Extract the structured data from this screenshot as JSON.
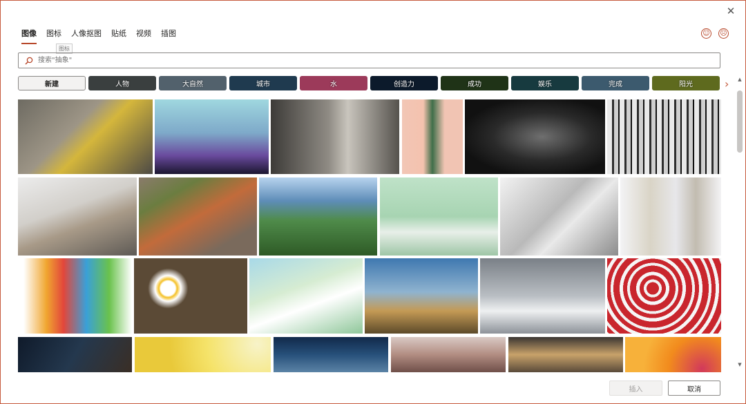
{
  "close_icon": "close-icon",
  "tabs": [
    {
      "label": "图像",
      "active": true
    },
    {
      "label": "图标"
    },
    {
      "label": "人像抠图"
    },
    {
      "label": "贴纸"
    },
    {
      "label": "视频"
    },
    {
      "label": "插图"
    }
  ],
  "tooltip": "图标",
  "feedback": {
    "happy_icon": "smile-icon",
    "sad_icon": "frown-icon"
  },
  "search": {
    "placeholder": "搜索\"抽象\"",
    "value": "",
    "icon": "search-icon"
  },
  "categories": [
    {
      "label": "新建",
      "color": "#f3f2f1"
    },
    {
      "label": "人物",
      "color": "#3a3f3f"
    },
    {
      "label": "大自然",
      "color": "#52616c"
    },
    {
      "label": "城市",
      "color": "#1f3a4f"
    },
    {
      "label": "水",
      "color": "#9c3a5a"
    },
    {
      "label": "创造力",
      "color": "#0c1a2b"
    },
    {
      "label": "成功",
      "color": "#1f3317"
    },
    {
      "label": "娱乐",
      "color": "#173a3f"
    },
    {
      "label": "完成",
      "color": "#3c5a6e"
    },
    {
      "label": "阳光",
      "color": "#5e6a1e"
    }
  ],
  "more_categories_icon": "chevron-right-icon",
  "images": [
    {
      "name": "workshop-overhead-photo",
      "bg": "linear-gradient(135deg,#6e6b62,#9d9586 40%,#d4b63c 55%,#4d4a45)"
    },
    {
      "name": "concert-hearts-photo",
      "bg": "linear-gradient(180deg,#9fd7df,#7ea9c9 45%,#6a4b9e 75%,#1b1630)"
    },
    {
      "name": "concrete-corridor-photo",
      "bg": "linear-gradient(90deg,#3d3b38,#8f8b84 45%,#c9c5bd 60%,#55524d)"
    },
    {
      "name": "cactus-pink-photo",
      "bg": "linear-gradient(90deg,#f2c6b6,#f4c2ae 35%,#3f6e49 50%,#f1c4b3 70%)"
    },
    {
      "name": "dark-particles-photo",
      "bg": "radial-gradient(ellipse at 55% 50%,#6f6f6f,#2a2a2a 45%,#111 75%)"
    },
    {
      "name": "birch-forest-photo",
      "bg": "repeating-linear-gradient(90deg,#e9e9e9 0 7px,#2e2e2e 7px 10px,#cfcfcf 10px 16px,#111 16px 18px)"
    },
    {
      "name": "cafe-chairs-photo",
      "bg": "linear-gradient(160deg,#ececec,#d2cfca 40%,#a89a88 60%,#5e5a55)"
    },
    {
      "name": "carrots-photo",
      "bg": "linear-gradient(150deg,#8a7b6b,#6b7d40 25%,#c26b3b 50%,#7a6a5c 80%)"
    },
    {
      "name": "bay-landscape-photo",
      "bg": "linear-gradient(180deg,#b7d3ee,#5e8db8 30%,#4f8b4a 55%,#2e5a26)"
    },
    {
      "name": "paper-figures-photo",
      "bg": "linear-gradient(180deg,#bfe2c8,#a7d4b2 50%,#e8efe9 70%,#9ec6a6)"
    },
    {
      "name": "open-book-photo",
      "bg": "linear-gradient(135deg,#f2f2f2,#b9b9b9 45%,#e9e9e9 60%,#8c8c8c)"
    },
    {
      "name": "cotton-jars-photo",
      "bg": "linear-gradient(90deg,#f3f3f5,#d9d4c6 30%,#e7e7ea 55%,#c2bcb0 75%,#f3f3f5)"
    },
    {
      "name": "colored-smoke-photo",
      "bg": "linear-gradient(90deg,#fff 5%,#f0a630 25%,#e2463b 40%,#3aa0d8 60%,#6ac24c 80%,#fff)"
    },
    {
      "name": "daisies-photo",
      "bg": "radial-gradient(circle at 30% 40%,#fff 8%,#f4c025 10%,#fff 14%,#5b4a36 22%),radial-gradient(circle at 70% 60%,#fff 8%,#e6b21f 10%,#fff 14%,#4e3f2f 22%)"
    },
    {
      "name": "white-blossom-photo",
      "bg": "linear-gradient(160deg,#a8d9e8,#d6ecd2 40%,#ffffff 60%,#8fc79a)"
    },
    {
      "name": "desert-cactus-photo",
      "bg": "linear-gradient(180deg,#3f78b0,#8fb3cf 45%,#c49a55 70%,#5c4a2a)"
    },
    {
      "name": "balance-spheres-photo",
      "bg": "linear-gradient(180deg,#7a8087,#b9bec3 50%,#eef0f1 70%,#8d9299)"
    },
    {
      "name": "red-umbrellas-photo",
      "bg": "repeating-radial-gradient(circle at 40% 40%,#c9262d 0 9px,#f2f2f2 9px 13px,#c9262d 13px 19px,#f6f6f6 19px 24px)"
    },
    {
      "name": "woman-dark-photo",
      "bg": "linear-gradient(120deg,#0f1a2a,#24384e 50%,#3a2e25)"
    },
    {
      "name": "lemon-slice-photo",
      "bg": "radial-gradient(circle at 90% 20%,#f7f3c9,#f5e36a 40%,#e9c93a 70%)"
    },
    {
      "name": "blue-water-glass-photo",
      "bg": "linear-gradient(180deg,#11294a,#27507a 50%,#5b83a6)"
    },
    {
      "name": "woman-sunset-photo",
      "bg": "linear-gradient(180deg,#d9c9c4,#b28d82 50%,#6f4f49)"
    },
    {
      "name": "baguette-photo",
      "bg": "linear-gradient(180deg,#3a3532,#c8a26a 50%,#5a4a3a)"
    },
    {
      "name": "orange-swirl-photo",
      "bg": "radial-gradient(circle at 80% 90%,#d2395b,#f28b1d 40%,#f7b13a 70%)"
    }
  ],
  "scrollbar": {
    "up_icon": "scroll-up-icon",
    "down_icon": "scroll-down-icon"
  },
  "footer": {
    "insert_label": "插入",
    "cancel_label": "取消"
  }
}
